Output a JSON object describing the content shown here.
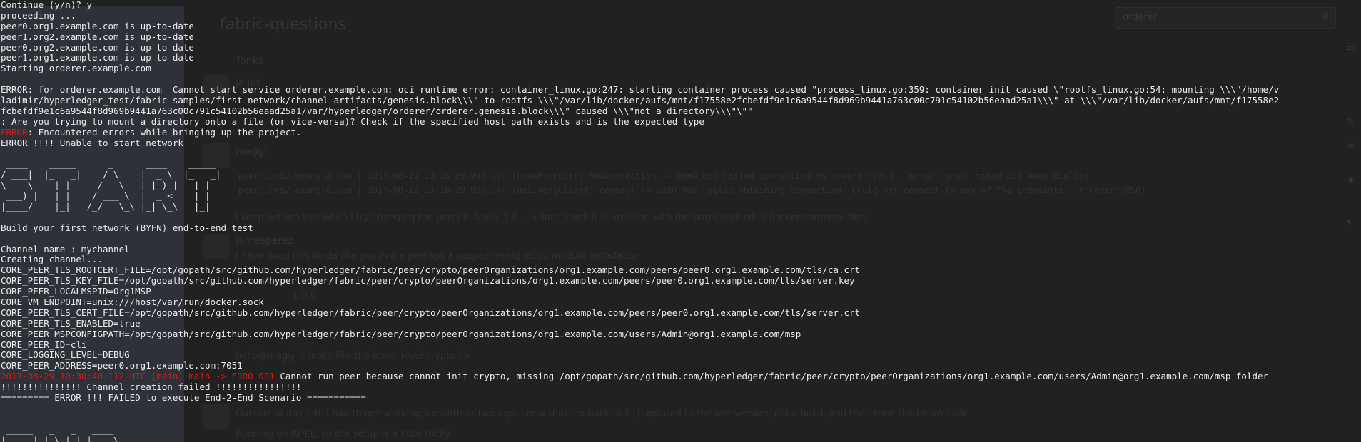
{
  "background_app": {
    "channel_title": "fabric-questions",
    "search_value": "orderer",
    "search_close_icon": "close-icon",
    "rail_icons": [
      "chat-icon",
      "star-icon",
      "pencil-icon",
      "list-icon",
      "bell-icon"
    ],
    "users": [
      "Tonks",
      "jaliot",
      "maggi",
      "jamesperez"
    ],
    "messages": [
      "I keep getting this when I try changing the ports in fabric 1.0.... i don't think it is an issue with the ports defined in docker-compose files",
      "I have fixed this kinda like you i've a perhaps a suspect PostgreSQL module installation",
      "hello@maggi it looks like the lower level crypto lib",
      "Outside of day job. I had things working a month or two ago... now that I'm back to it, I updated to the last version, did a build, and then tried the below code",
      "Running on RHEL, so the setup is a little tricky"
    ],
    "code_lines": [
      "peer0.org2.example.com    | 2017-08-12 13:16:29.998 UTC [ConnProducer] NewConnection -> ERRO 00d Failed connecting to orderer:7050 , error: grpc: timed out when dialing",
      "peer0.org2.example.com    | 2017-08-12 13:16:29.998 UTC [deliveryClient] connect -> ERRO 00e Failed obtaining connection: Could not connect to any of the endpoints: [orderer:7050]"
    ],
    "version_label": "1.0.0"
  },
  "terminal": {
    "pre_lines": [
      "Continue (y/n)? y",
      "proceeding ...",
      "peer0.org1.example.com is up-to-date",
      "peer1.org2.example.com is up-to-date",
      "peer0.org2.example.com is up-to-date",
      "peer1.org1.example.com is up-to-date",
      "Starting orderer.example.com",
      "",
      "ERROR: for orderer.example.com  Cannot start service orderer.example.com: oci runtime error: container_linux.go:247: starting container process caused \"process_linux.go:359: container init caused \\\"rootfs_linux.go:54: mounting \\\\\\\"/home/v",
      "ladimir/hyperledger_test/fabric-samples/first-network/channel-artifacts/genesis.block\\\\\\\" to rootfs \\\\\\\"/var/lib/docker/aufs/mnt/f17558e2fcbefdf9e1c6a9544f8d969b9441a763c00c791c54102b56eaad25a1\\\\\\\" at \\\\\\\"/var/lib/docker/aufs/mnt/f17558e2",
      "fcbefdf9e1c6a9544f8d969b9441a763c00c791c54102b56eaad25a1/var/hyperledger/orderer/orderer.genesis.block\\\\\\\" caused \\\\\\\"not a directory\\\\\\\"\\\"\"",
      ": Are you trying to mount a directory onto a file (or vice-versa)? Check if the specified host path exists and is the expected type"
    ],
    "encountered_prefix": "ERROR",
    "encountered_rest": ": Encountered errors while bringing up the project.",
    "unable_line": "ERROR !!!! Unable to start network",
    "ascii_start": " ____    _____      _      ____    _____ \n/ ___|  |_   _|    / \\    |  _ \\  |_   _|\n\\___ \\    | |     / _ \\   | |_) |   | |  \n ___) |   | |    / ___ \\  |  _ <    | |  \n|____/    |_|   /_/   \\_\\ |_| \\_\\   |_|  ",
    "post_lines": [
      "",
      "Build your first network (BYFN) end-to-end test",
      "",
      "Channel name : mychannel",
      "Creating channel...",
      "CORE_PEER_TLS_ROOTCERT_FILE=/opt/gopath/src/github.com/hyperledger/fabric/peer/crypto/peerOrganizations/org1.example.com/peers/peer0.org1.example.com/tls/ca.crt",
      "CORE_PEER_TLS_KEY_FILE=/opt/gopath/src/github.com/hyperledger/fabric/peer/crypto/peerOrganizations/org1.example.com/peers/peer0.org1.example.com/tls/server.key",
      "CORE_PEER_LOCALMSPID=Org1MSP",
      "CORE_VM_ENDPOINT=unix:///host/var/run/docker.sock",
      "CORE_PEER_TLS_CERT_FILE=/opt/gopath/src/github.com/hyperledger/fabric/peer/crypto/peerOrganizations/org1.example.com/peers/peer0.org1.example.com/tls/server.crt",
      "CORE_PEER_TLS_ENABLED=true",
      "CORE_PEER_MSPCONFIGPATH=/opt/gopath/src/github.com/hyperledger/fabric/peer/crypto/peerOrganizations/org1.example.com/users/Admin@org1.example.com/msp",
      "CORE_PEER_ID=cli",
      "CORE_LOGGING_LEVEL=DEBUG",
      "CORE_PEER_ADDRESS=peer0.org1.example.com:7051"
    ],
    "log_red": "2017-08-29 10:30:40.112 UTC [main] main -> ERRO 001",
    "log_rest": " Cannot run peer because cannot init crypto, missing /opt/gopath/src/github.com/hyperledger/fabric/peer/crypto/peerOrganizations/org1.example.com/users/Admin@org1.example.com/msp folder",
    "channel_failed": "!!!!!!!!!!!!!!! Channel creation failed !!!!!!!!!!!!!!!!",
    "scenario_failed": "========= ERROR !!! FAILED to execute End-2-End Scenario ===========",
    "ascii_bottom": " _____   _   _   ____   \n| ____| | \\ | | |  _ \\  "
  },
  "colors": {
    "terminal_text": "#ececec",
    "error_red": "#d31a1a",
    "left_panel": "#434a53"
  }
}
